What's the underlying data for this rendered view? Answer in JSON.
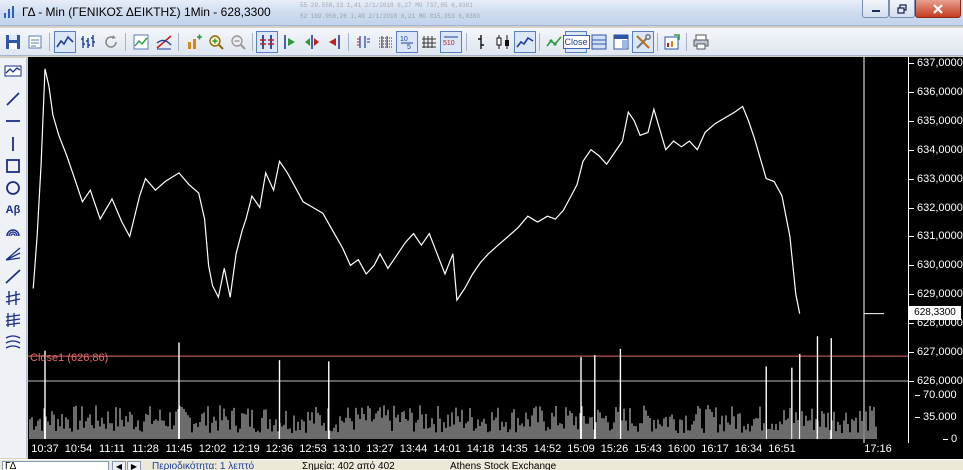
{
  "window": {
    "title": "ΓΔ - Min (ΓΕΝΙΚΟΣ ΔΕΙΚΤΗΣ) 1Min - 628,3300"
  },
  "background_table_rows": [
    "55          29.558,33        1,41       2/1/2018          6,27 MO 737,05           6,0381",
    "52         189.059,26        1,49       2/1/2018          6,21 MO 815,353          6,0383"
  ],
  "toolbar": {
    "close_button_label": "Close",
    "icons": [
      "save-icon",
      "properties-icon",
      "line-chart-icon",
      "ohlc-chart-icon",
      "refresh-icon",
      "compare-icon",
      "indicator-icon",
      "add-study-icon",
      "zoom-in-icon",
      "zoom-out-icon",
      "volume-bars-icon",
      "arrow-right-icon",
      "arrow-both-icon",
      "arrow-left-icon",
      "data-window-icon",
      "grid-lines-icon",
      "period-5-icon",
      "period-10-icon",
      "bar-icon",
      "candle-icon",
      "mountain-icon",
      "trend-icon",
      "layout-icon",
      "window-icon",
      "tools-icon",
      "export-icon",
      "print-icon"
    ]
  },
  "left_tools": {
    "text_tool_label": "Αβ",
    "icons": [
      "chart-type-icon",
      "line-tool-icon",
      "horizontal-line-icon",
      "vertical-line-icon",
      "rectangle-icon",
      "ellipse-icon",
      "text-tool-icon",
      "arc-tool-icon",
      "fan-tool-icon",
      "ray-tool-icon",
      "channel-tool-icon",
      "fibonacci-icon",
      "cycles-icon"
    ]
  },
  "chart_data": {
    "type": "line",
    "title": "",
    "price_axis_ticks": [
      "637,0000",
      "636,0000",
      "635,0000",
      "634,0000",
      "633,0000",
      "632,0000",
      "631,0000",
      "630,0000",
      "629,0000",
      "628,0000",
      "627,0000",
      "626,0000"
    ],
    "volume_axis_ticks": [
      "70.000",
      "35.000",
      "0"
    ],
    "x_ticks": [
      "10:37",
      "10:54",
      "11:11",
      "11:28",
      "11:45",
      "12:02",
      "12:19",
      "12:36",
      "12:53",
      "13:10",
      "13:27",
      "13:44",
      "14:01",
      "14:18",
      "14:35",
      "14:52",
      "15:09",
      "15:26",
      "15:43",
      "16:00",
      "16:17",
      "16:34",
      "16:51",
      "17:16"
    ],
    "ylim": [
      626.0,
      637.0
    ],
    "current_price_label": "628,3300",
    "current_price": 628.33,
    "reference_line": {
      "label": "Close1 (626,86)",
      "value": 626.86,
      "color": "#e46b6b"
    },
    "price_series": [
      {
        "time": "10:31",
        "value": 629.2
      },
      {
        "time": "10:33",
        "value": 631.0
      },
      {
        "time": "10:35",
        "value": 633.5
      },
      {
        "time": "10:37",
        "value": 636.8
      },
      {
        "time": "10:39",
        "value": 636.2
      },
      {
        "time": "10:41",
        "value": 635.2
      },
      {
        "time": "10:44",
        "value": 634.5
      },
      {
        "time": "10:48",
        "value": 633.8
      },
      {
        "time": "10:52",
        "value": 633.0
      },
      {
        "time": "10:56",
        "value": 632.2
      },
      {
        "time": "11:00",
        "value": 632.6
      },
      {
        "time": "11:05",
        "value": 631.6
      },
      {
        "time": "11:11",
        "value": 632.3
      },
      {
        "time": "11:16",
        "value": 631.5
      },
      {
        "time": "11:20",
        "value": 631.0
      },
      {
        "time": "11:25",
        "value": 632.4
      },
      {
        "time": "11:28",
        "value": 633.0
      },
      {
        "time": "11:33",
        "value": 632.6
      },
      {
        "time": "11:38",
        "value": 632.9
      },
      {
        "time": "11:45",
        "value": 633.2
      },
      {
        "time": "11:50",
        "value": 632.8
      },
      {
        "time": "11:55",
        "value": 632.5
      },
      {
        "time": "11:58",
        "value": 631.6
      },
      {
        "time": "12:00",
        "value": 630.0
      },
      {
        "time": "12:02",
        "value": 629.3
      },
      {
        "time": "12:05",
        "value": 628.9
      },
      {
        "time": "12:08",
        "value": 629.9
      },
      {
        "time": "12:11",
        "value": 628.9
      },
      {
        "time": "12:14",
        "value": 630.4
      },
      {
        "time": "12:17",
        "value": 631.2
      },
      {
        "time": "12:19",
        "value": 631.6
      },
      {
        "time": "12:22",
        "value": 632.4
      },
      {
        "time": "12:26",
        "value": 632.0
      },
      {
        "time": "12:29",
        "value": 633.2
      },
      {
        "time": "12:33",
        "value": 632.6
      },
      {
        "time": "12:36",
        "value": 633.6
      },
      {
        "time": "12:40",
        "value": 633.2
      },
      {
        "time": "12:44",
        "value": 632.7
      },
      {
        "time": "12:48",
        "value": 632.2
      },
      {
        "time": "12:53",
        "value": 632.0
      },
      {
        "time": "12:58",
        "value": 631.8
      },
      {
        "time": "13:03",
        "value": 631.2
      },
      {
        "time": "13:08",
        "value": 630.6
      },
      {
        "time": "13:12",
        "value": 630.0
      },
      {
        "time": "13:16",
        "value": 630.2
      },
      {
        "time": "13:20",
        "value": 629.7
      },
      {
        "time": "13:24",
        "value": 630.0
      },
      {
        "time": "13:27",
        "value": 630.4
      },
      {
        "time": "13:31",
        "value": 629.9
      },
      {
        "time": "13:35",
        "value": 630.3
      },
      {
        "time": "13:40",
        "value": 630.8
      },
      {
        "time": "13:44",
        "value": 631.1
      },
      {
        "time": "13:48",
        "value": 630.7
      },
      {
        "time": "13:52",
        "value": 631.1
      },
      {
        "time": "13:56",
        "value": 630.4
      },
      {
        "time": "14:00",
        "value": 629.7
      },
      {
        "time": "14:04",
        "value": 630.4
      },
      {
        "time": "14:06",
        "value": 628.8
      },
      {
        "time": "14:10",
        "value": 629.2
      },
      {
        "time": "14:14",
        "value": 629.7
      },
      {
        "time": "14:18",
        "value": 630.1
      },
      {
        "time": "14:22",
        "value": 630.4
      },
      {
        "time": "14:27",
        "value": 630.7
      },
      {
        "time": "14:32",
        "value": 631.0
      },
      {
        "time": "14:37",
        "value": 631.3
      },
      {
        "time": "14:42",
        "value": 631.7
      },
      {
        "time": "14:47",
        "value": 631.5
      },
      {
        "time": "14:52",
        "value": 631.7
      },
      {
        "time": "14:56",
        "value": 631.6
      },
      {
        "time": "15:00",
        "value": 631.9
      },
      {
        "time": "15:04",
        "value": 632.4
      },
      {
        "time": "15:07",
        "value": 632.8
      },
      {
        "time": "15:10",
        "value": 633.6
      },
      {
        "time": "15:14",
        "value": 634.0
      },
      {
        "time": "15:18",
        "value": 633.8
      },
      {
        "time": "15:22",
        "value": 633.5
      },
      {
        "time": "15:26",
        "value": 633.9
      },
      {
        "time": "15:30",
        "value": 634.3
      },
      {
        "time": "15:33",
        "value": 635.3
      },
      {
        "time": "15:36",
        "value": 635.0
      },
      {
        "time": "15:39",
        "value": 634.5
      },
      {
        "time": "15:43",
        "value": 634.6
      },
      {
        "time": "15:46",
        "value": 635.4
      },
      {
        "time": "15:49",
        "value": 634.7
      },
      {
        "time": "15:52",
        "value": 634.0
      },
      {
        "time": "15:56",
        "value": 634.3
      },
      {
        "time": "16:00",
        "value": 634.1
      },
      {
        "time": "16:04",
        "value": 634.3
      },
      {
        "time": "16:08",
        "value": 634.0
      },
      {
        "time": "16:12",
        "value": 634.6
      },
      {
        "time": "16:17",
        "value": 634.9
      },
      {
        "time": "16:22",
        "value": 635.1
      },
      {
        "time": "16:27",
        "value": 635.3
      },
      {
        "time": "16:31",
        "value": 635.5
      },
      {
        "time": "16:34",
        "value": 635.0
      },
      {
        "time": "16:37",
        "value": 634.4
      },
      {
        "time": "16:40",
        "value": 633.7
      },
      {
        "time": "16:43",
        "value": 633.0
      },
      {
        "time": "16:47",
        "value": 632.9
      },
      {
        "time": "16:51",
        "value": 632.4
      },
      {
        "time": "16:55",
        "value": 631.0
      },
      {
        "time": "16:58",
        "value": 629.0
      },
      {
        "time": "17:00",
        "value": 628.33
      }
    ],
    "volume_series": [
      {
        "time": "10:37",
        "value": 45000
      },
      {
        "time": "11:45",
        "value": 58000
      },
      {
        "time": "12:36",
        "value": 30000
      },
      {
        "time": "13:01",
        "value": 28000
      },
      {
        "time": "15:09",
        "value": 35000
      },
      {
        "time": "15:16",
        "value": 38000
      },
      {
        "time": "15:29",
        "value": 48000
      },
      {
        "time": "16:43",
        "value": 20000
      },
      {
        "time": "16:56",
        "value": 18000
      },
      {
        "time": "17:00",
        "value": 40000
      },
      {
        "time": "17:09",
        "value": 68000
      },
      {
        "time": "17:16",
        "value": 65000
      }
    ]
  },
  "statusbar": {
    "select_value": "ΓΔ",
    "hint": "Περιοδικότητα: 1 λεπτό",
    "points": "Σημεία: 402 από 402",
    "exchange": "Athens Stock Exchange"
  },
  "colors": {
    "chart_background": "#000000",
    "price_line": "#ffffff",
    "reference_line": "#e46b6b"
  }
}
